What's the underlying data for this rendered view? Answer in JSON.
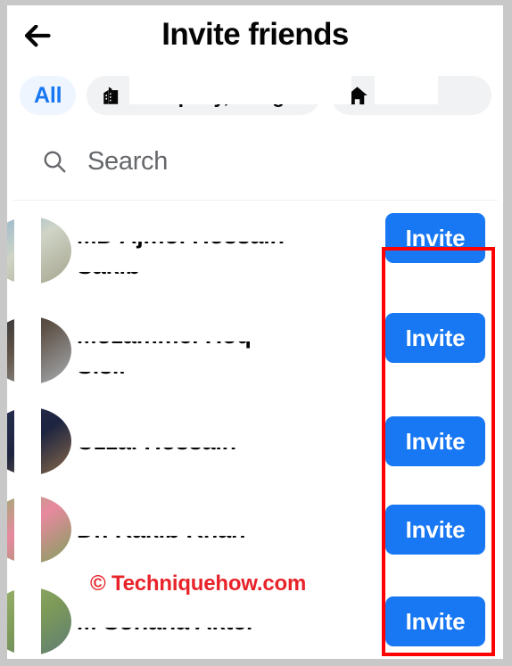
{
  "header": {
    "title": "Invite friends",
    "back_icon": "arrow-left-icon"
  },
  "filters": {
    "chips": [
      {
        "label": "All",
        "icon": "none",
        "selected": true,
        "redacted": false
      },
      {
        "label": "Company, Bangladesh",
        "icon": "building-icon",
        "selected": false,
        "redacted": true
      },
      {
        "label": "Home",
        "icon": "home-icon",
        "selected": false,
        "redacted": true
      }
    ]
  },
  "search": {
    "placeholder": "Search",
    "value": "",
    "icon": "search-icon"
  },
  "list": {
    "rows": [
      {
        "name_line1": "MD Ajmol Hossain",
        "name_line2": "Sakib",
        "button": "Invite",
        "avatar_colors": [
          "#7fa8c9",
          "#b7b09a"
        ]
      },
      {
        "name_line1": "Mozammel Hoq",
        "name_line2": "Sisir",
        "button": "Invite",
        "avatar_colors": [
          "#3d3d3d",
          "#9aa0a6"
        ]
      },
      {
        "name_line1": "Uzzal Hossain",
        "name_line2": "",
        "button": "Invite",
        "avatar_colors": [
          "#2d3561",
          "#1c2340"
        ]
      },
      {
        "name_line1": "Dr. Rakib Khan",
        "name_line2": "",
        "button": "Invite",
        "avatar_colors": [
          "#8fae6d",
          "#e486a2"
        ]
      },
      {
        "name_line1": "M Sohana Akter",
        "name_line2": "",
        "button": "Invite",
        "avatar_colors": [
          "#9db56e",
          "#6f8f57"
        ]
      }
    ]
  },
  "annotation": {
    "box_color": "#ff0000",
    "target": "invite-buttons-column"
  },
  "watermark": {
    "text": "© Techniquehow.com",
    "color": "#e8232a"
  },
  "colors": {
    "primary_blue": "#1877f2",
    "chip_selected_bg": "#eef5ff",
    "chip_bg": "#f1f2f4",
    "text_primary": "#050505",
    "text_secondary": "#65676b",
    "frame": "#c8c8c8"
  }
}
